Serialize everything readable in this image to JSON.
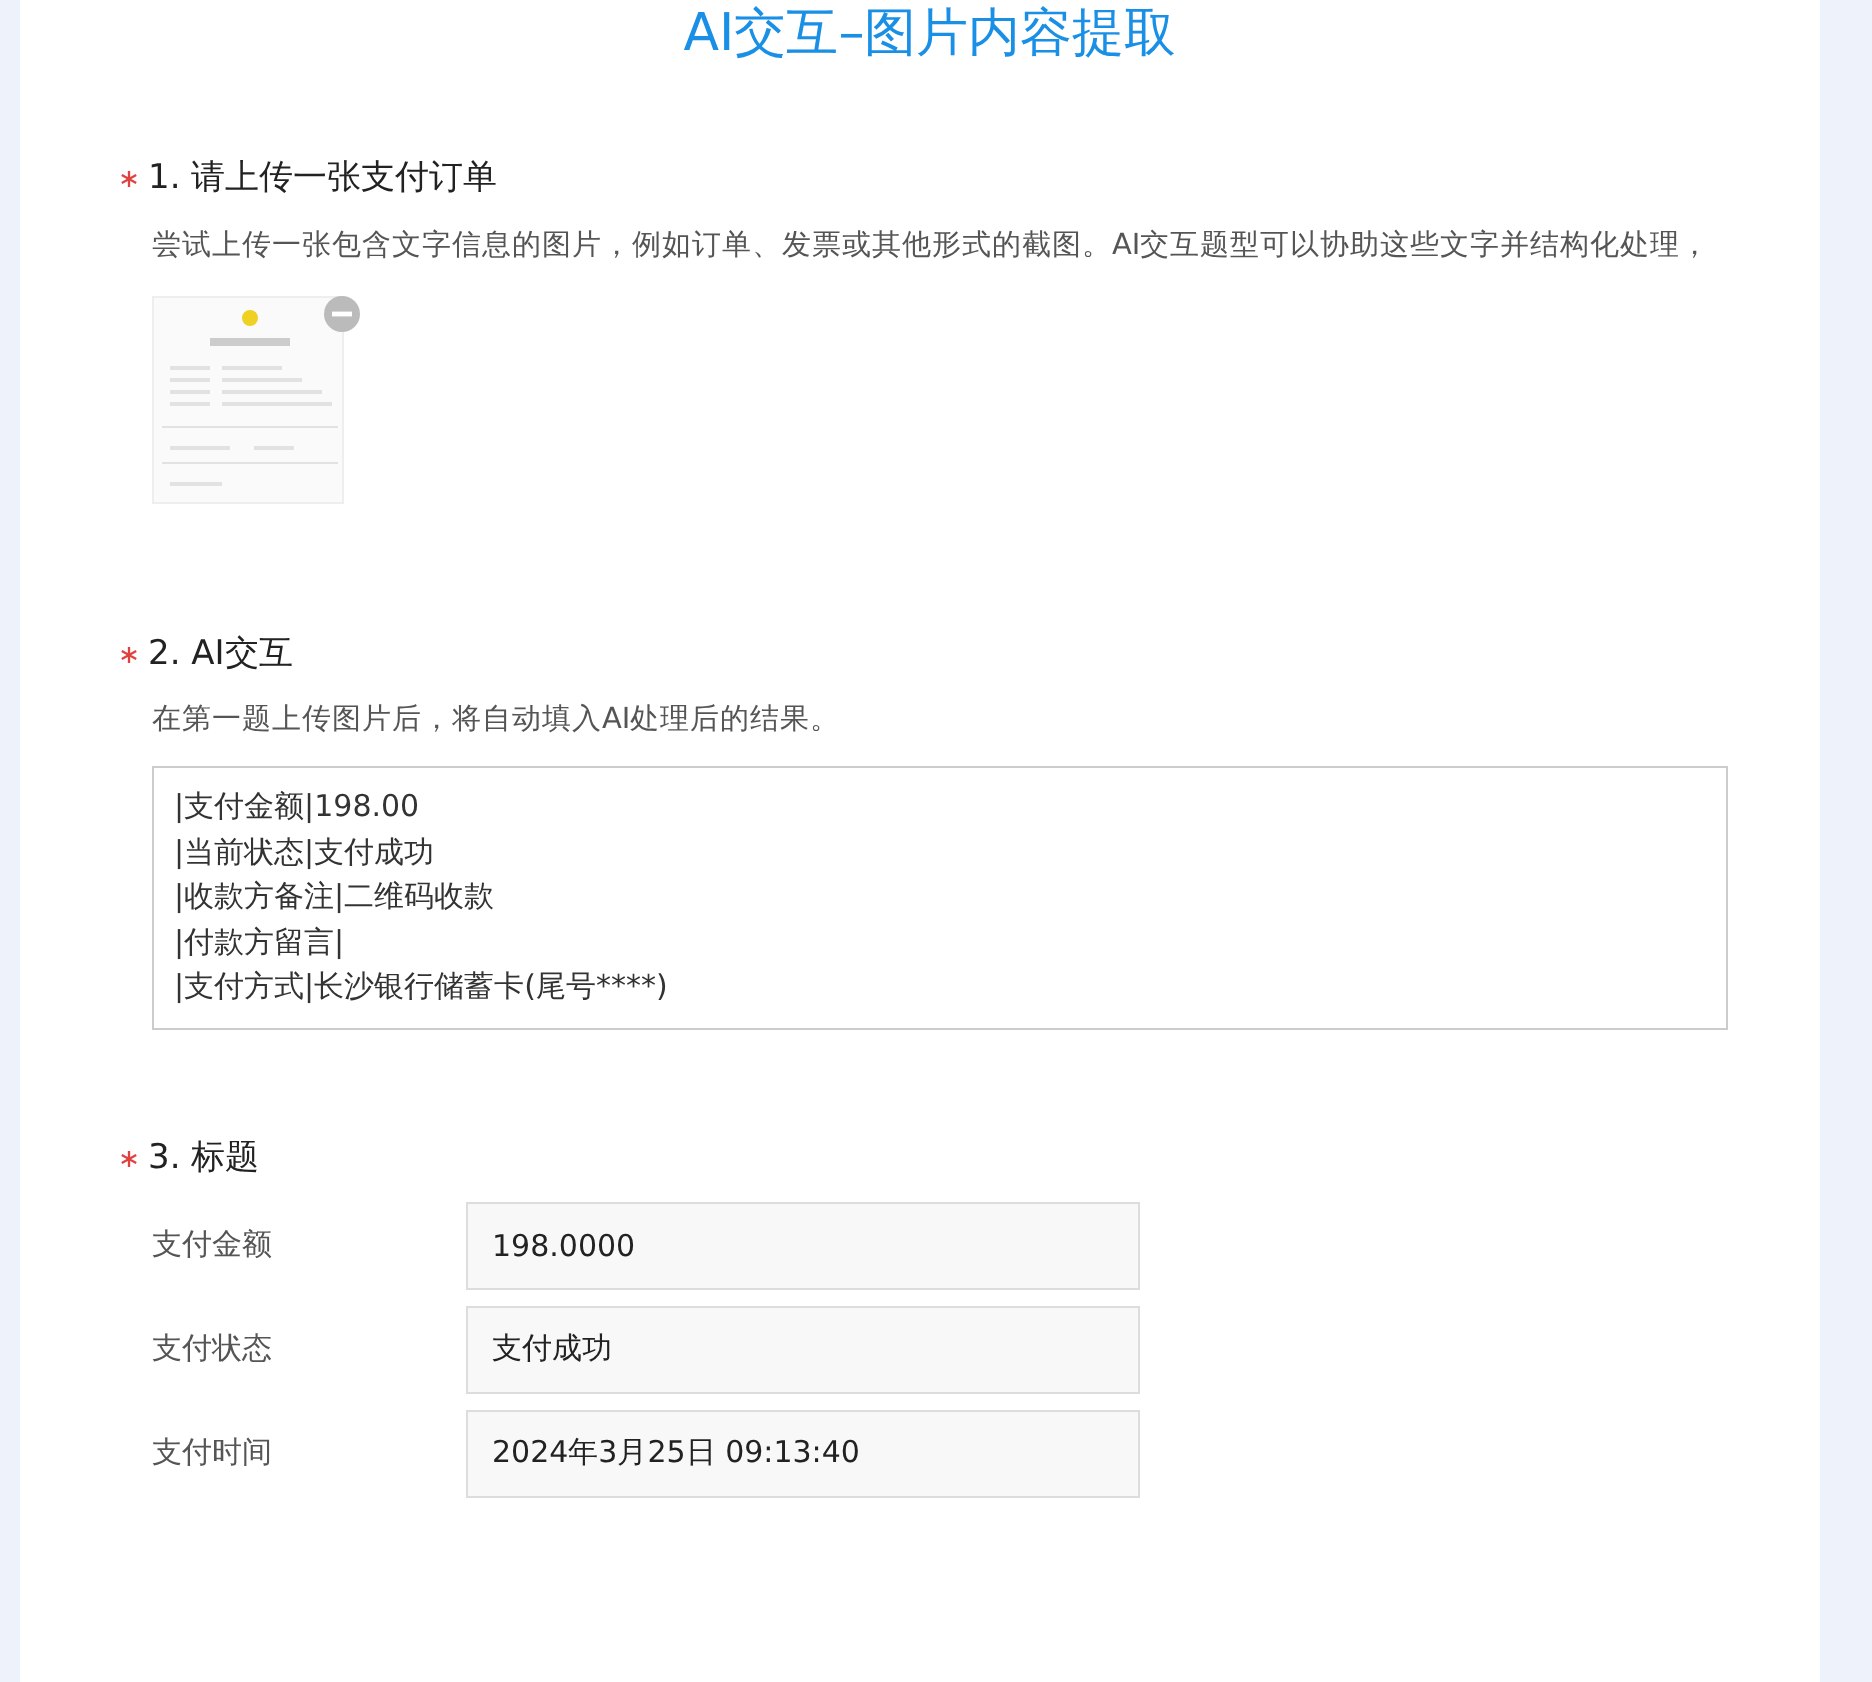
{
  "title": "AI交互–图片内容提取",
  "questions": [
    {
      "kind": "upload",
      "required": true,
      "number": "1.",
      "title": "请上传一张支付订单",
      "description": "尝试上传一张包含文字信息的图片，例如订单、发票或其他形式的截图。AI交互题型可以协助这些文字并结构化处理，"
    },
    {
      "kind": "textarea",
      "required": true,
      "number": "2.",
      "title": "AI交互",
      "description": "在第一题上传图片后，将自动填入AI处理后的结果。",
      "lines": [
        "|支付金额|198.00",
        "|当前状态|支付成功",
        "|收款方备注|二维码收款",
        "|付款方留言|",
        "|支付方式|长沙银行储蓄卡(尾号****)"
      ]
    },
    {
      "kind": "fields",
      "required": true,
      "number": "3.",
      "title": "标题",
      "fields": [
        {
          "label": "支付金额",
          "value": "198.0000"
        },
        {
          "label": "支付状态",
          "value": "支付成功"
        },
        {
          "label": "支付时间",
          "value": "2024年3月25日 09:13:40"
        }
      ]
    }
  ]
}
